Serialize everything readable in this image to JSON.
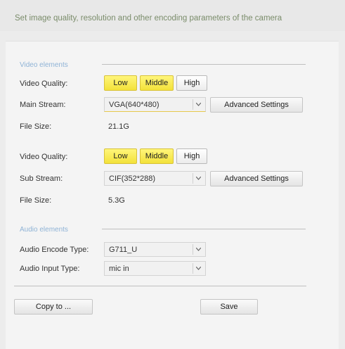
{
  "header": {
    "description": "Set image quality, resolution and other encoding parameters of the camera"
  },
  "video_section": {
    "title": "Video elements"
  },
  "main_stream": {
    "quality_label": "Video Quality:",
    "quality_options": [
      "Low",
      "Middle",
      "High"
    ],
    "active_options": [
      "Low",
      "Middle"
    ],
    "stream_label": "Main Stream:",
    "stream_value": "VGA(640*480)",
    "advanced_label": "Advanced Settings",
    "file_size_label": "File Size:",
    "file_size_value": "21.1G"
  },
  "sub_stream": {
    "quality_label": "Video Quality:",
    "quality_options": [
      "Low",
      "Middle",
      "High"
    ],
    "active_options": [
      "Low",
      "Middle"
    ],
    "stream_label": "Sub Stream:",
    "stream_value": "CIF(352*288)",
    "advanced_label": "Advanced Settings",
    "file_size_label": "File Size:",
    "file_size_value": "5.3G"
  },
  "audio_section": {
    "title": "Audio elements",
    "encode_label": "Audio Encode Type:",
    "encode_value": "G711_U",
    "input_label": "Audio Input Type:",
    "input_value": "mic in"
  },
  "footer": {
    "copy_label": "Copy to ...",
    "save_label": "Save"
  },
  "colors": {
    "active_button": "#f3e23a",
    "header_text": "#7a8c6a",
    "section_title": "#8fb3d6"
  }
}
